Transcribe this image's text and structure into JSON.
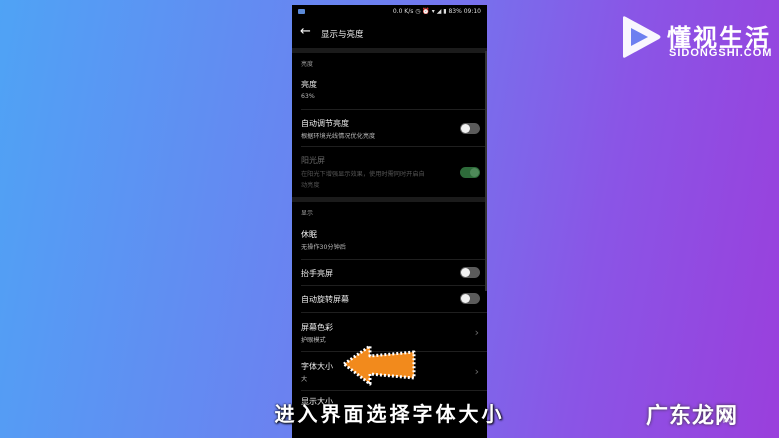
{
  "brand": {
    "name": "懂视生活",
    "sub": "SIDONGSHI.COM"
  },
  "status_bar": {
    "left": "0.0 K/s ◷ ⏰ ▾ ◢ ▮ 83% 09:10"
  },
  "header": {
    "title": "显示与亮度"
  },
  "sections": {
    "brightness_header": "亮度",
    "display_header": "显示"
  },
  "items": {
    "brightness": {
      "title": "亮度",
      "sub": "63%"
    },
    "auto_brightness": {
      "title": "自动调节亮度",
      "sub": "根据环境光线情况优化亮度",
      "toggle": "off"
    },
    "sunlight": {
      "title": "阳光屏",
      "sub1": "在阳光下增强显示效果，使用时需同时开启自",
      "sub2": "动亮度",
      "toggle": "on"
    },
    "sleep": {
      "title": "休眠",
      "sub": "无操作30分钟后"
    },
    "raise_wake": {
      "title": "抬手亮屏",
      "toggle": "off"
    },
    "auto_rotate": {
      "title": "自动旋转屏幕",
      "toggle": "off"
    },
    "color": {
      "title": "屏幕色彩",
      "sub": "护眼模式"
    },
    "font_size": {
      "title": "字体大小",
      "sub": "大"
    },
    "display_size": {
      "title": "显示大小"
    }
  },
  "caption": "进入界面选择字体大小",
  "watermark": {
    "main": "广东龙网",
    "overlay": "活"
  },
  "colors": {
    "arrow": "#f28a1c",
    "toggle_on": "#4f8a5a"
  },
  "icons": {
    "back": "arrow-left-icon",
    "chevron": "chevron-right-icon"
  }
}
